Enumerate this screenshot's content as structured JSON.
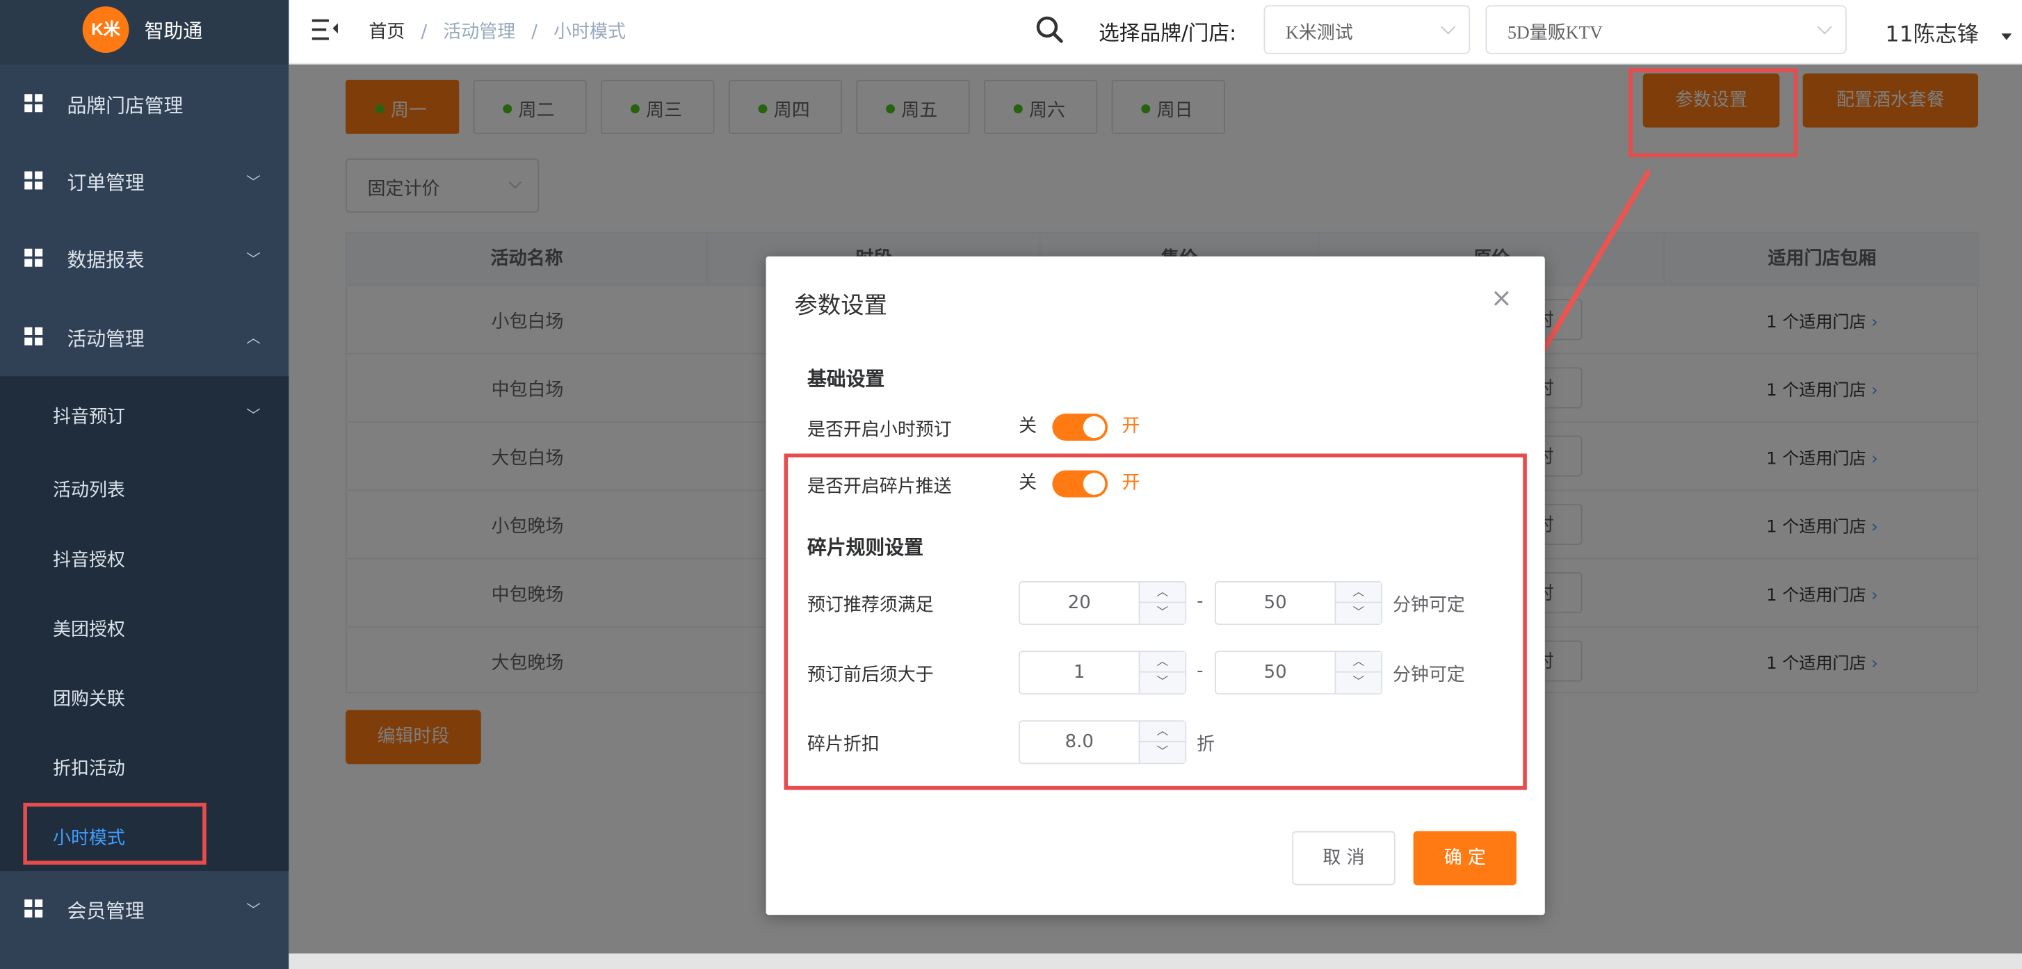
{
  "app": {
    "logo_badge": "K米",
    "name": "智助通"
  },
  "colors": {
    "accent": "#ff7a12",
    "sidebar": "#304156",
    "sidebar_sub": "#1f2d3d",
    "active_link": "#409eff",
    "highlight": "#e74c4c"
  },
  "sidebar": {
    "items": [
      {
        "label": "品牌门店管理",
        "icon": "grid-icon"
      },
      {
        "label": "订单管理",
        "icon": "grid-icon",
        "arrow": "chevron-down-icon"
      },
      {
        "label": "数据报表",
        "icon": "grid-icon",
        "arrow": "chevron-down-icon"
      },
      {
        "label": "活动管理",
        "icon": "grid-icon",
        "arrow": "chevron-up-icon"
      },
      {
        "label": "会员管理",
        "icon": "grid-icon",
        "arrow": "chevron-down-icon"
      }
    ],
    "subitems": [
      "抖音预订",
      "活动列表",
      "抖音授权",
      "美团授权",
      "团购关联",
      "折扣活动",
      "小时模式"
    ],
    "active_subitem": "小时模式"
  },
  "header": {
    "breadcrumb": [
      "首页",
      "活动管理",
      "小时模式"
    ],
    "separator": "/",
    "store_label": "选择品牌/门店:",
    "brand_select": "K米测试",
    "store_select": "5D量贩KTV",
    "user": "11陈志锋"
  },
  "main": {
    "day_tabs": [
      "周一",
      "周二",
      "周三",
      "周四",
      "周五",
      "周六",
      "周日"
    ],
    "active_day": "周一",
    "buttons": {
      "params": "参数设置",
      "drinks": "配置酒水套餐",
      "edit_periods": "编辑时段"
    },
    "pricing_select": "固定计价",
    "table": {
      "columns": [
        "活动名称",
        "时段",
        "售价",
        "原价",
        "适用门店包厢"
      ],
      "rows": [
        {
          "name": "小包白场",
          "button": "时",
          "stores": "1 个适用门店"
        },
        {
          "name": "中包白场",
          "button": "时",
          "stores": "1 个适用门店"
        },
        {
          "name": "大包白场",
          "button": "时",
          "stores": "1 个适用门店"
        },
        {
          "name": "小包晚场",
          "button": "时",
          "stores": "1 个适用门店"
        },
        {
          "name": "中包晚场",
          "button": "时",
          "stores": "1 个适用门店"
        },
        {
          "name": "大包晚场",
          "button": "时",
          "stores": "1 个适用门店"
        }
      ],
      "store_arrow": "›"
    }
  },
  "dialog": {
    "title": "参数设置",
    "close": "×",
    "basic_title": "基础设置",
    "hour_booking": {
      "label": "是否开启小时预订",
      "off": "关",
      "on": "开",
      "enabled": true
    },
    "fragment_push": {
      "label": "是否开启碎片推送",
      "off": "关",
      "on": "开",
      "enabled": true
    },
    "rules_title": "碎片规则设置",
    "recommend": {
      "label": "预订推荐须满足",
      "min": "20",
      "max": "50",
      "dash": "-",
      "suffix": "分钟可定"
    },
    "gap": {
      "label": "预订前后须大于",
      "min": "1",
      "max": "50",
      "dash": "-",
      "suffix": "分钟可定"
    },
    "discount": {
      "label": "碎片折扣",
      "value": "8.0",
      "suffix": "折"
    },
    "cancel": "取 消",
    "confirm": "确 定"
  }
}
